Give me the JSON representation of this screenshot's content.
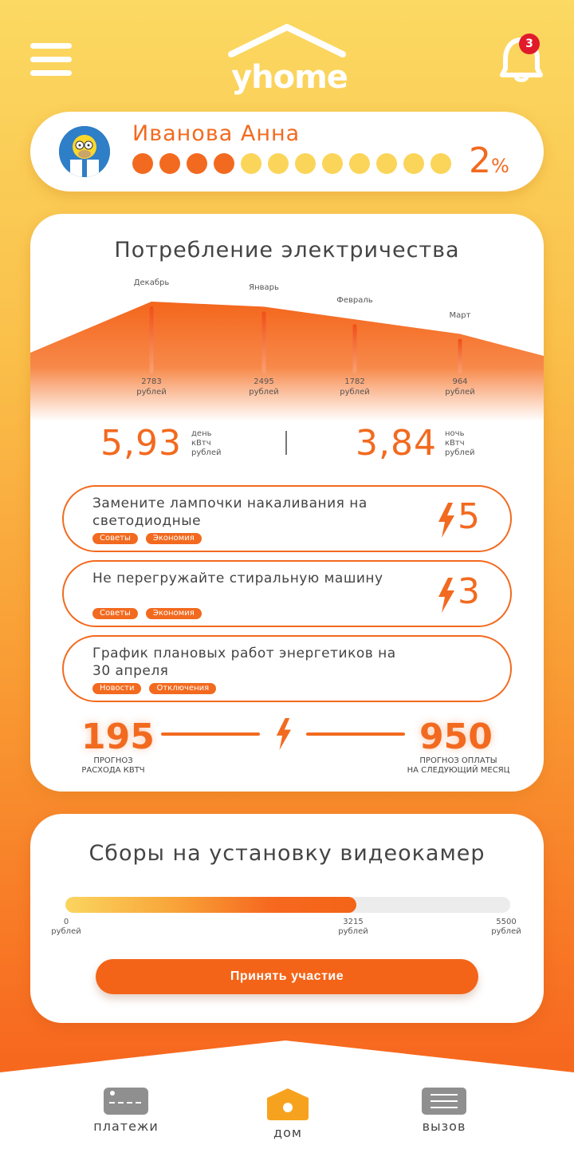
{
  "header": {
    "logo_text": "yhome",
    "notifications_count": "3",
    "menu_icon": "hamburger-icon",
    "bell_icon": "bell-icon"
  },
  "profile": {
    "name": "Иванова Анна",
    "level_filled": 4,
    "level_total": 12,
    "percent_value": "2",
    "percent_sign": "%"
  },
  "electricity": {
    "title": "Потребление электричества",
    "day_value": "5,93",
    "day_units": [
      "день",
      "кВтч",
      "рублей"
    ],
    "night_value": "3,84",
    "night_units": [
      "ночь",
      "кВтч",
      "рублей"
    ]
  },
  "chart_data": {
    "type": "area",
    "categories": [
      "Декабрь",
      "Январь",
      "Февраль",
      "Март"
    ],
    "values": [
      2783,
      2495,
      1782,
      964
    ],
    "unit_label": "рублей"
  },
  "tips": [
    {
      "text": "Замените лампочки накаливания на светодиодные",
      "tags": [
        "Советы",
        "Экономия"
      ],
      "count": "5"
    },
    {
      "text": "Не перегружайте стиральную машину",
      "tags": [
        "Советы",
        "Экономия"
      ],
      "count": "3"
    },
    {
      "text": "График плановых работ энергетиков на 30 апреля",
      "tags": [
        "Новости",
        "Отключения"
      ],
      "count": ""
    }
  ],
  "forecast": {
    "left_value": "195",
    "left_label_1": "ПРОГНОЗ",
    "left_label_2": "РАСХОДА КВТЧ",
    "right_value": "950",
    "right_label_1": "ПРОГНОЗ ОПЛАТЫ",
    "right_label_2": "НА СЛЕДУЮЩИЙ МЕСЯЦ"
  },
  "fundraising": {
    "title": "Сборы на установку видеокамер",
    "min_value": "0",
    "current_value": "3215",
    "max_value": "5500",
    "unit_label": "рублей",
    "progress_fraction": 0.6545,
    "button_label": "Принять участие"
  },
  "nav": {
    "items": [
      {
        "label": "платежи",
        "icon": "card-icon"
      },
      {
        "label": "дом",
        "icon": "home-icon"
      },
      {
        "label": "вызов",
        "icon": "call-list-icon"
      }
    ]
  },
  "colors": {
    "accent": "#f26a1f",
    "accent_light": "#fbd55a",
    "home_icon": "#f7a21e",
    "inactive_icon": "#8f8f8f"
  }
}
